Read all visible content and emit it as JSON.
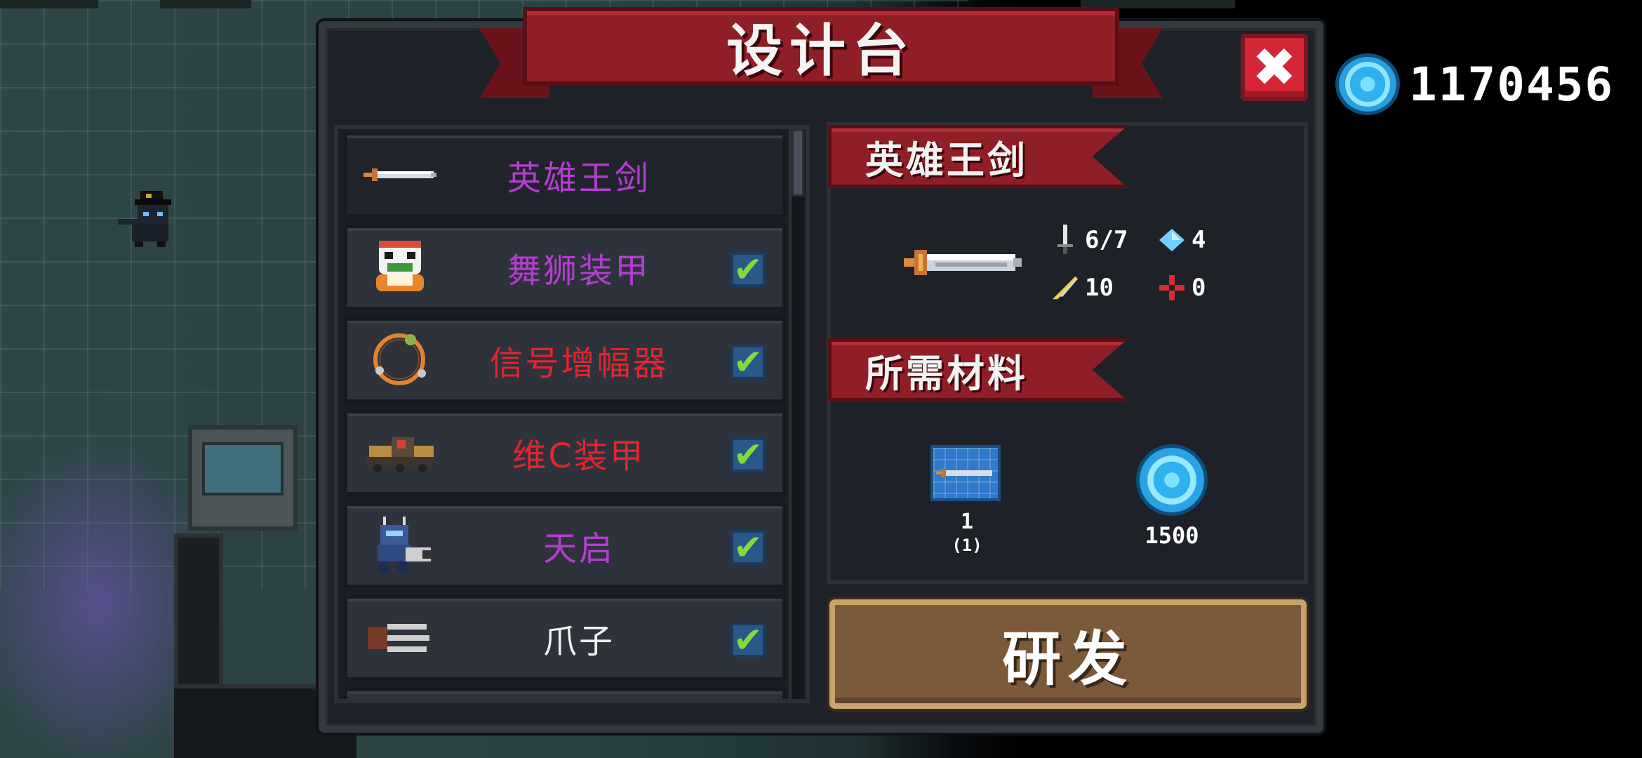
{
  "currency": {
    "icon": "gem-icon",
    "amount": "1170456"
  },
  "panel": {
    "title": "设计台",
    "close_icon": "close-icon",
    "close_label": "✖"
  },
  "list": {
    "items": [
      {
        "name": "英雄王剑",
        "color": "#b23ed0",
        "icon": "sword-icon",
        "owned": false,
        "selected": true
      },
      {
        "name": "舞狮装甲",
        "color": "#b23ed0",
        "icon": "lion-dance-icon",
        "owned": true,
        "selected": false
      },
      {
        "name": "信号增幅器",
        "color": "#e0262f",
        "icon": "ring-icon",
        "owned": true,
        "selected": false
      },
      {
        "name": "维C装甲",
        "color": "#e0262f",
        "icon": "tank-icon",
        "owned": true,
        "selected": false
      },
      {
        "name": "天启",
        "color": "#b23ed0",
        "icon": "mech-icon",
        "owned": true,
        "selected": false
      },
      {
        "name": "爪子",
        "color": "#f0f0f0",
        "icon": "claw-icon",
        "owned": true,
        "selected": false
      }
    ],
    "check_glyph": "✔"
  },
  "detail": {
    "name": "英雄王剑",
    "weapon_icon": "sword-icon",
    "stats": {
      "damage": "6/7",
      "energy": "4",
      "crit": "10",
      "spread": "0"
    },
    "materials_title": "所需材料",
    "materials": [
      {
        "icon": "blueprint-icon",
        "count": "1",
        "owned": "(1)"
      },
      {
        "icon": "gem-icon",
        "count": "1500"
      }
    ],
    "research_label": "研发"
  },
  "colors": {
    "ribbon_red": "#8f1e26",
    "close_red": "#d42636",
    "button_brown": "#7b5a3c",
    "gem_blue": "#2fb1ef",
    "check_green": "#7fdc3a"
  }
}
